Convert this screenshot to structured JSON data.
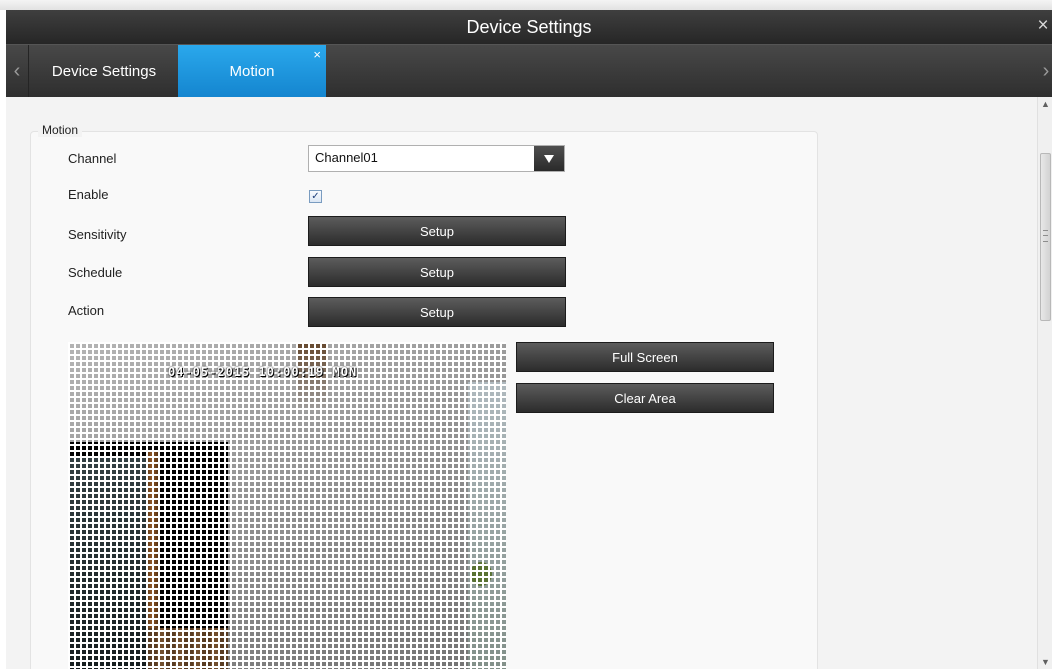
{
  "window": {
    "title": "Device Settings",
    "close_glyph": "×"
  },
  "tabs": [
    {
      "label": "Device Settings",
      "active": false
    },
    {
      "label": "Motion",
      "active": true,
      "close_glyph": "×"
    }
  ],
  "tab_nav": {
    "prev_glyph": "‹",
    "next_glyph": "›"
  },
  "motion": {
    "group_title": "Motion",
    "channel": {
      "label": "Channel",
      "value": "Channel01"
    },
    "enable": {
      "label": "Enable",
      "checked": true,
      "check_glyph": "✓"
    },
    "sensitivity": {
      "label": "Sensitivity",
      "button": "Setup"
    },
    "schedule": {
      "label": "Schedule",
      "button": "Setup"
    },
    "action": {
      "label": "Action",
      "button": "Setup"
    },
    "preview": {
      "osd": "04-05-2015 10:00:19 MON"
    },
    "full_screen_button": "Full Screen",
    "clear_area_button": "Clear Area"
  },
  "scrollbar": {
    "up_glyph": "▲",
    "down_glyph": "▼"
  },
  "colors": {
    "accent": "#1a95dd",
    "titlebar": "#2e2e2e",
    "button": "#3a3a3a"
  }
}
